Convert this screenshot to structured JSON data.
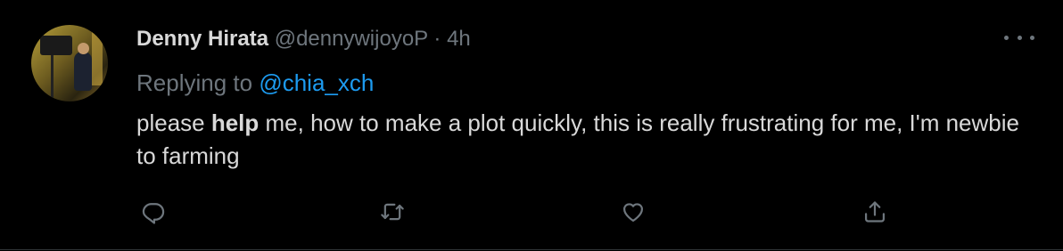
{
  "tweet": {
    "author_name": "Denny Hirata",
    "author_handle": "@dennywijoyoP",
    "separator": " · ",
    "time": "4h",
    "replying_prefix": "Replying to ",
    "replying_handle": "@chia_xch",
    "body_before": "please ",
    "body_bold": "help",
    "body_after": " me, how to make a plot quickly, this is really frustrating for me, I'm newbie to farming"
  },
  "icons": {
    "more": "more-options-icon",
    "reply": "reply-icon",
    "retweet": "retweet-icon",
    "like": "like-icon",
    "share": "share-icon"
  },
  "colors": {
    "background": "#000000",
    "text": "#d9d9d9",
    "secondary": "#6e767d",
    "link": "#1d9bf0"
  }
}
